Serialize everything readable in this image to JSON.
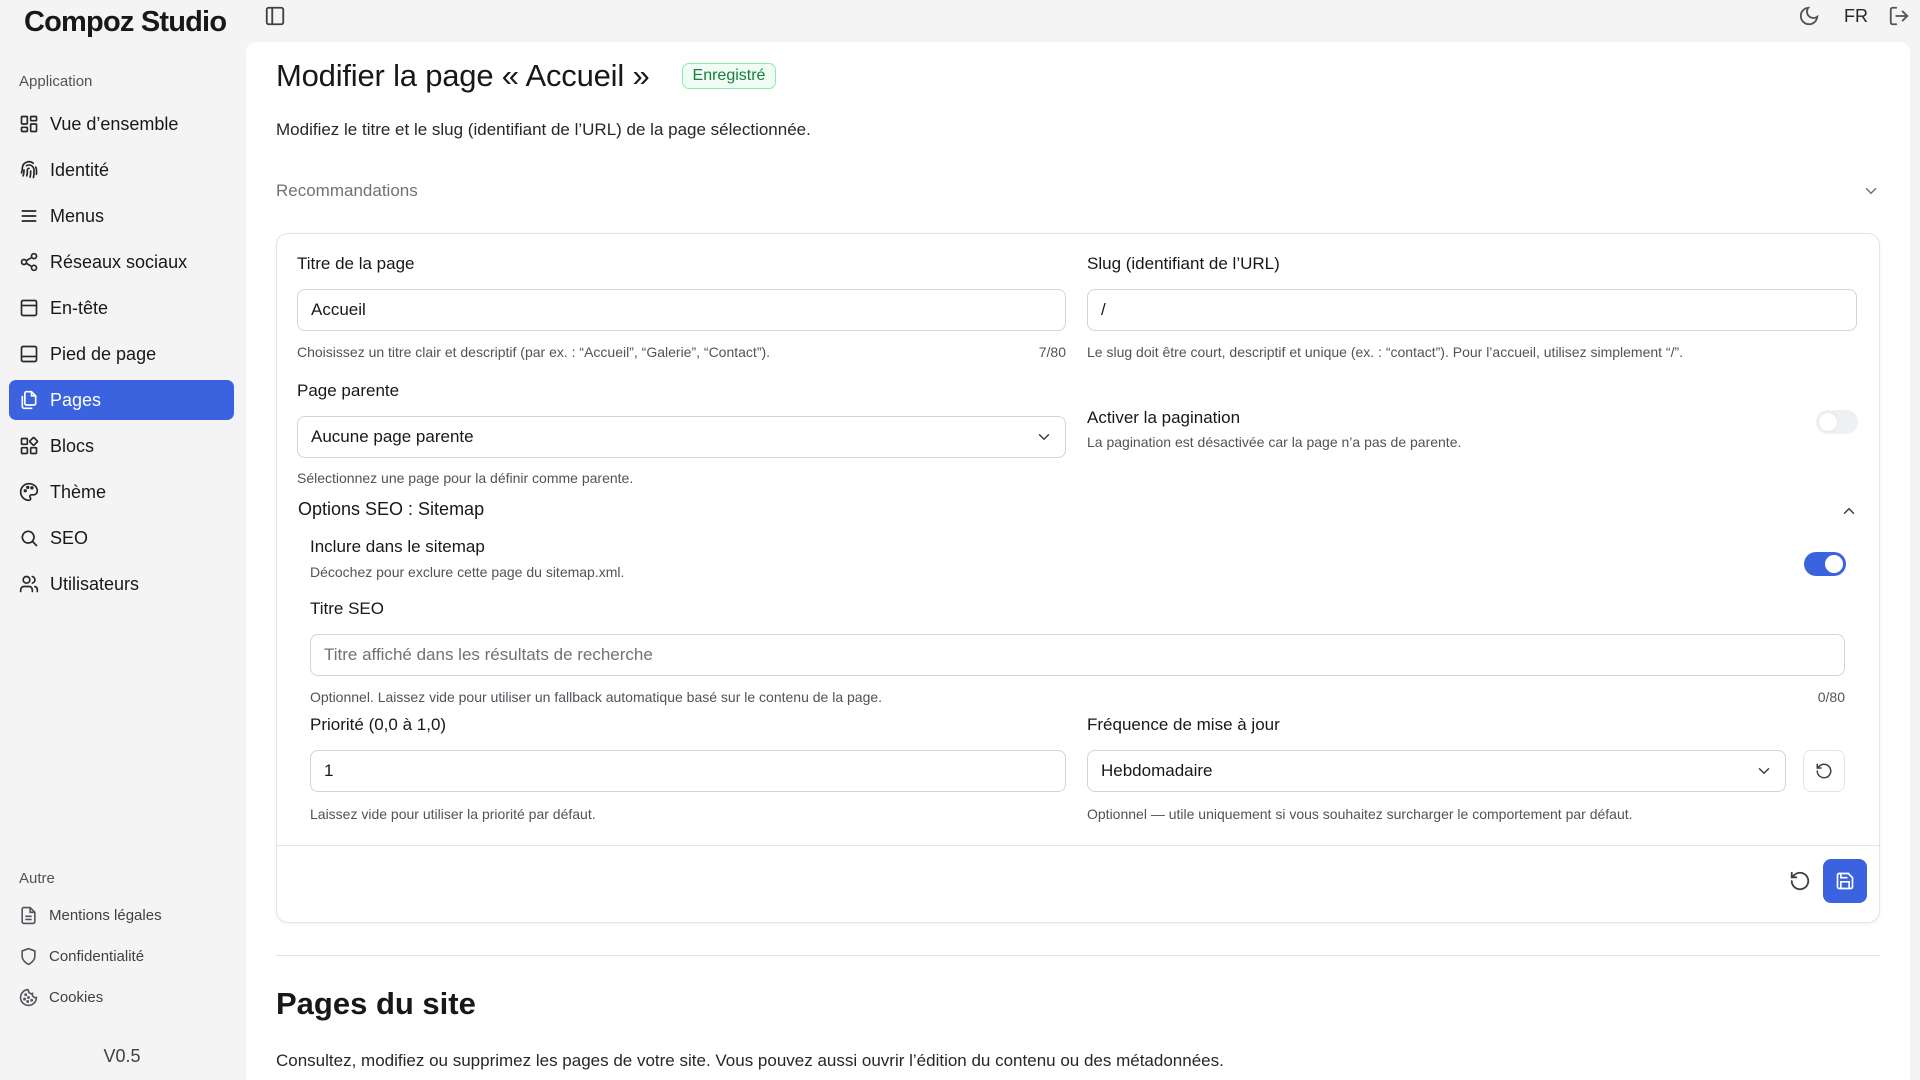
{
  "app": {
    "brand": "Compoz Studio",
    "version": "V0.5"
  },
  "sidebar": {
    "group_app": "Application",
    "group_other": "Autre",
    "items": [
      {
        "label": "Vue d’ensemble",
        "icon": "grid-icon"
      },
      {
        "label": "Identité",
        "icon": "fingerprint-icon"
      },
      {
        "label": "Menus",
        "icon": "menu-lines-icon"
      },
      {
        "label": "Réseaux sociaux",
        "icon": "share-icon"
      },
      {
        "label": "En-tête",
        "icon": "header-layout-icon"
      },
      {
        "label": "Pied de page",
        "icon": "footer-layout-icon"
      },
      {
        "label": "Pages",
        "icon": "pages-copy-icon",
        "active": true
      },
      {
        "label": "Blocs",
        "icon": "blocks-icon"
      },
      {
        "label": "Thème",
        "icon": "palette-icon"
      },
      {
        "label": "SEO",
        "icon": "search-icon"
      },
      {
        "label": "Utilisateurs",
        "icon": "users-icon"
      }
    ],
    "other_items": [
      {
        "label": "Mentions légales",
        "icon": "document-icon"
      },
      {
        "label": "Confidentialité",
        "icon": "shield-icon"
      },
      {
        "label": "Cookies",
        "icon": "cookie-icon"
      }
    ]
  },
  "topbar": {
    "lang": "FR"
  },
  "page": {
    "title": "Modifier la page « Accueil »",
    "badge": "Enregistré",
    "description": "Modifiez le titre et le slug (identifiant de l’URL) de la page sélectionnée.",
    "recommendations": "Recommandations"
  },
  "form": {
    "title_label": "Titre de la page",
    "title_value": "Accueil",
    "title_hint": "Choisissez un titre clair et descriptif (par ex. : “Accueil”, “Galerie”, “Contact”).",
    "title_count": "7/80",
    "slug_label": "Slug (identifiant de l’URL)",
    "slug_value": "/",
    "slug_hint": "Le slug doit être court, descriptif et unique (ex. : “contact”). Pour l’accueil, utilisez simplement “/”.",
    "parent_label": "Page parente",
    "parent_value": "Aucune page parente",
    "parent_hint": "Sélectionnez une page pour la définir comme parente.",
    "pagination_label": "Activer la pagination",
    "pagination_hint": "La pagination est désactivée car la page n’a pas de parente.",
    "seo_section": "Options SEO : Sitemap",
    "sitemap_label": "Inclure dans le sitemap",
    "sitemap_hint": "Décochez pour exclure cette page du sitemap.xml.",
    "seo_title_label": "Titre SEO",
    "seo_title_placeholder": "Titre affiché dans les résultats de recherche",
    "seo_title_hint": "Optionnel. Laissez vide pour utiliser un fallback automatique basé sur le contenu de la page.",
    "seo_title_count": "0/80",
    "priority_label": "Priorité (0,0 à 1,0)",
    "priority_value": "1",
    "priority_hint": "Laissez vide pour utiliser la priorité par défaut.",
    "frequency_label": "Fréquence de mise à jour",
    "frequency_value": "Hebdomadaire",
    "frequency_hint": "Optionnel — utile uniquement si vous souhaitez surcharger le comportement par défaut."
  },
  "pages_section": {
    "title": "Pages du site",
    "description": "Consultez, modifiez ou supprimez les pages de votre site. Vous pouvez aussi ouvrir l’édition du contenu ou des métadonnées."
  },
  "colors": {
    "accent": "#3b63e0",
    "success": "#15803d",
    "panel": "#ffffff",
    "background": "#f4f4f5"
  }
}
